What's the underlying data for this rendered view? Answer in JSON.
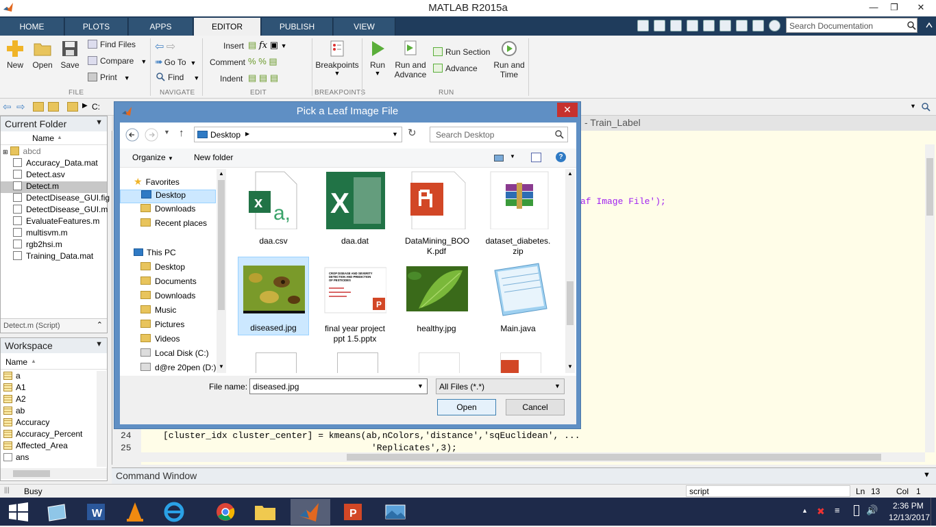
{
  "app": {
    "title": "MATLAB R2015a"
  },
  "tabs": [
    "HOME",
    "PLOTS",
    "APPS",
    "EDITOR",
    "PUBLISH",
    "VIEW"
  ],
  "active_tab": "EDITOR",
  "doc_search_placeholder": "Search Documentation",
  "ribbon": {
    "file": {
      "new": "New",
      "open": "Open",
      "save": "Save",
      "find_files": "Find Files",
      "compare": "Compare",
      "print": "Print",
      "section": "FILE"
    },
    "navigate": {
      "go_to": "Go To",
      "find": "Find",
      "section": "NAVIGATE"
    },
    "edit": {
      "insert": "Insert",
      "comment": "Comment",
      "indent": "Indent",
      "section": "EDIT"
    },
    "breakpoints": {
      "label": "Breakpoints",
      "section": "BREAKPOINTS"
    },
    "run": {
      "run": "Run",
      "run_and_advance_1": "Run and",
      "run_and_advance_2": "Advance",
      "run_section": "Run Section",
      "advance": "Advance",
      "run_and_time_1": "Run and",
      "run_and_time_2": "Time",
      "section": "RUN"
    }
  },
  "pathbar": {
    "drive": "C:"
  },
  "current_folder": {
    "title": "Current Folder",
    "name_header": "Name",
    "items": [
      "abcd",
      "Accuracy_Data.mat",
      "Detect.asv",
      "Detect.m",
      "DetectDisease_GUI.fig",
      "DetectDisease_GUI.m",
      "EvaluateFeatures.m",
      "multisvm.m",
      "rgb2hsi.m",
      "Training_Data.mat"
    ],
    "selected": "Detect.m",
    "details": "Detect.m (Script)"
  },
  "workspace": {
    "title": "Workspace",
    "name_header": "Name",
    "items": [
      "a",
      "A1",
      "A2",
      "ab",
      "Accuracy",
      "Accuracy_Percent",
      "Affected_Area",
      "ans"
    ]
  },
  "editor": {
    "header_fragment": "- Train_Label",
    "line_visible": "af Image File');",
    "lines": [
      {
        "num": "24",
        "text": "[cluster_idx cluster_center] = kmeans(ab,nColors,'distance','sqEuclidean', ..."
      },
      {
        "num": "25",
        "text": "'Replicates',3);"
      }
    ]
  },
  "command_window": {
    "title": "Command Window"
  },
  "status": {
    "busy": "Busy",
    "mode": "script",
    "ln_label": "Ln",
    "ln": "13",
    "col_label": "Col",
    "col": "1"
  },
  "dialog": {
    "title": "Pick a Leaf Image File",
    "address": "Desktop",
    "search_placeholder": "Search Desktop",
    "organize": "Organize",
    "new_folder": "New folder",
    "nav": {
      "favorites": "Favorites",
      "favorites_items": [
        "Desktop",
        "Downloads",
        "Recent places"
      ],
      "this_pc": "This PC",
      "pc_items": [
        "Desktop",
        "Documents",
        "Downloads",
        "Music",
        "Pictures",
        "Videos",
        "Local Disk (C:)",
        "d@re 20pen (D:)"
      ]
    },
    "files": [
      {
        "name": "daa.csv",
        "icon": "excel-csv-icon"
      },
      {
        "name": "daa.dat",
        "icon": "excel-icon"
      },
      {
        "name": "DataMining_BOOK.pdf",
        "display": "DataMining_BOO K.pdf",
        "icon": "pdf-icon"
      },
      {
        "name": "dataset_diabetes.zip",
        "display": "dataset_diabetes. zip",
        "icon": "winrar-icon"
      },
      {
        "name": "diseased.jpg",
        "icon": "diseased-leaf-thumbnail"
      },
      {
        "name": "final year project ppt 1.5.pptx",
        "icon": "pptx-thumbnail"
      },
      {
        "name": "healthy.jpg",
        "icon": "healthy-leaf-thumbnail"
      },
      {
        "name": "Main.java",
        "icon": "notepad-icon"
      }
    ],
    "pptx_thumb_text": [
      "CROP DISEASE AND SEVERITY",
      "DETECTION AND PREDICTION",
      "OF PESTICIDES"
    ],
    "selected_file": "diseased.jpg",
    "file_name_label": "File name:",
    "file_name_value": "diseased.jpg",
    "filter_value": "All Files (*.*)",
    "open": "Open",
    "cancel": "Cancel"
  },
  "taskbar": {
    "time": "2:36 PM",
    "date": "12/13/2017"
  },
  "colors": {
    "tab_bar": "#1f3c5c",
    "dialog_frame": "#5f8fc4",
    "close_red": "#c7312e",
    "editor_bg": "#fffde8",
    "taskbar": "#1e2a4a",
    "selection": "#cce8ff"
  }
}
